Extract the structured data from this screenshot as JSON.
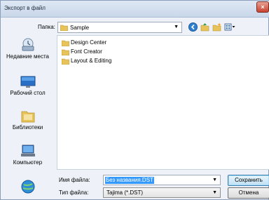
{
  "window": {
    "title": "Экспорт в файл",
    "close_label": "×"
  },
  "folder": {
    "label": "Папка:",
    "value": "Sample"
  },
  "places": [
    {
      "label": "Недавние места",
      "icon": "recent-places-icon"
    },
    {
      "label": "Рабочий стол",
      "icon": "desktop-icon"
    },
    {
      "label": "Библиотеки",
      "icon": "libraries-icon"
    },
    {
      "label": "Компьютер",
      "icon": "computer-icon"
    },
    {
      "label": "",
      "icon": "network-icon"
    }
  ],
  "files": [
    {
      "name": "Design Center"
    },
    {
      "name": "Font Creator"
    },
    {
      "name": "Layout & Editing"
    }
  ],
  "form": {
    "filename_label": "Имя файла:",
    "filename_value": "Без названия.DST",
    "filetype_label": "Тип файла:",
    "filetype_value": "Tajima (*.DST)"
  },
  "buttons": {
    "save": "Сохранить",
    "cancel": "Отмена"
  },
  "colors": {
    "folder_yellow": "#e8c35a",
    "selection": "#3399ff"
  }
}
